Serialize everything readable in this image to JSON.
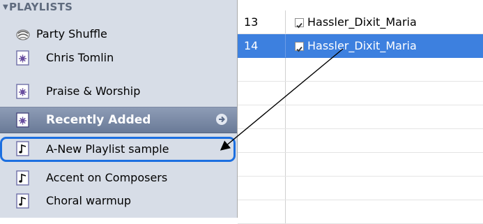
{
  "sidebar": {
    "header": "PLAYLISTS",
    "items": [
      {
        "label": "Party Shuffle",
        "icon": "party-shuffle-icon"
      },
      {
        "label": "Chris Tomlin",
        "icon": "smart-playlist-icon"
      },
      {
        "label": "Praise & Worship",
        "icon": "smart-playlist-icon"
      },
      {
        "label": "Recently Added",
        "icon": "smart-playlist-icon",
        "state": "selected"
      },
      {
        "label": "A-New Playlist sample",
        "icon": "playlist-icon",
        "state": "drop-target"
      },
      {
        "label": "Accent on Composers",
        "icon": "playlist-icon"
      },
      {
        "label": "Choral warmup",
        "icon": "playlist-icon"
      }
    ]
  },
  "tracks": [
    {
      "number": "13",
      "name": "Hassler_Dixit_Maria",
      "checked": true
    },
    {
      "number": "14",
      "name": "Hassler_Dixit_Maria",
      "checked": true,
      "selected": true
    }
  ],
  "colors": {
    "sidebar_bg": "#d7dde7",
    "selected_row": "#6a7a97",
    "drop_border": "#1c6fe0",
    "track_selection": "#3d80df"
  }
}
